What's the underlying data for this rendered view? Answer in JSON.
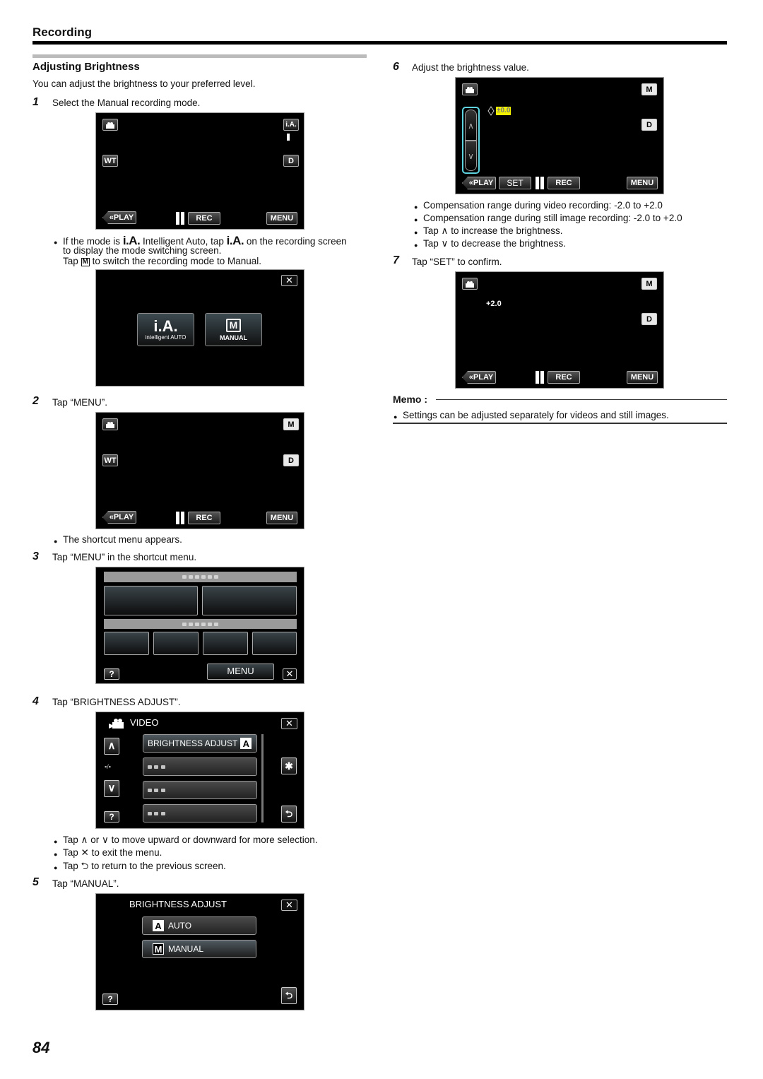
{
  "section": {
    "title": "Recording"
  },
  "heading": "Adjusting Brightness",
  "intro": "You can adjust the brightness to your preferred level.",
  "steps": [
    {
      "num": "1",
      "text": "Select the Manual recording mode."
    },
    {
      "num": "2",
      "text": "Tap “MENU”."
    },
    {
      "num": "3",
      "text": "Tap “MENU” in the shortcut menu."
    },
    {
      "num": "4",
      "text": "Tap “BRIGHTNESS ADJUST”."
    },
    {
      "num": "5",
      "text": "Tap “MANUAL”."
    },
    {
      "num": "6",
      "text": "Adjust the brightness value."
    },
    {
      "num": "7",
      "text": "Tap “SET” to confirm."
    }
  ],
  "step1_notes": {
    "line1_a": "If the mode is",
    "ia_glyph": "i.A.",
    "line1_b": "Intelligent Auto, tap",
    "line1_c": "on the recording screen",
    "line2": "to display the mode switching screen.",
    "line3_a": "Tap",
    "m_glyph": "M",
    "line3_b": "to switch the recording mode to Manual."
  },
  "step2_note": "The shortcut menu appears.",
  "step4_notes": [
    {
      "a": "Tap",
      "icon1": "∧",
      "mid": "or",
      "icon2": "∨",
      "b": "to move upward or downward for more selection."
    },
    {
      "a": "Tap",
      "icon1": "✕",
      "b": "to exit the menu."
    },
    {
      "a": "Tap",
      "icon1": "⮌",
      "b": "to return to the previous screen."
    }
  ],
  "step6_notes": [
    "Compensation range during video recording: -2.0 to +2.0",
    "Compensation range during still image recording: -2.0 to +2.0"
  ],
  "step6_tap_notes": [
    {
      "a": "Tap",
      "icon": "∧",
      "b": "to increase the brightness."
    },
    {
      "a": "Tap",
      "icon": "∨",
      "b": "to decrease the brightness."
    }
  ],
  "memo": {
    "title": "Memo :",
    "items": [
      "Settings can be adjusted separately for videos and still images."
    ]
  },
  "page_number": "84",
  "screens": {
    "rec_ia": {
      "mode": "i.A.",
      "zoom": "WT",
      "display": "D",
      "play": "«PLAY",
      "rec": "REC",
      "menu": "MENU"
    },
    "mode_select": {
      "ia_label": "i.A.",
      "ia_sub": "intelligent AUTO",
      "m_label": "M",
      "m_sub": "MANUAL",
      "close": "✕"
    },
    "rec_m": {
      "mode": "M",
      "zoom": "WT",
      "display": "D",
      "play": "«PLAY",
      "rec": "REC",
      "menu": "MENU"
    },
    "shortcut": {
      "help": "?",
      "menu": "MENU",
      "close": "✕"
    },
    "video_menu": {
      "title": "VIDEO",
      "page": "▪/▪",
      "items": [
        {
          "label": "BRIGHTNESS ADJUST",
          "badge": "A"
        }
      ],
      "up": "∧",
      "down": "∨",
      "help": "?",
      "close": "✕",
      "back": "⮌",
      "settings": "✱"
    },
    "brightness_menu": {
      "title": "BRIGHTNESS ADJUST",
      "options": [
        {
          "badge": "A",
          "label": "AUTO"
        },
        {
          "badge": "M",
          "label": "MANUAL"
        }
      ],
      "help": "?",
      "close": "✕",
      "back": "⮌"
    },
    "adjust": {
      "mode": "M",
      "display": "D",
      "value": "±0.0",
      "up": "∧",
      "down": "∨",
      "play": "«PLAY",
      "set": "SET",
      "rec": "REC",
      "menu": "MENU"
    },
    "confirmed": {
      "mode": "M",
      "display": "D",
      "value": "+2.0",
      "play": "«PLAY",
      "rec": "REC",
      "menu": "MENU"
    }
  },
  "colors": {
    "highlight": "#f2f200",
    "slider_outline": "#5fd3e0"
  }
}
